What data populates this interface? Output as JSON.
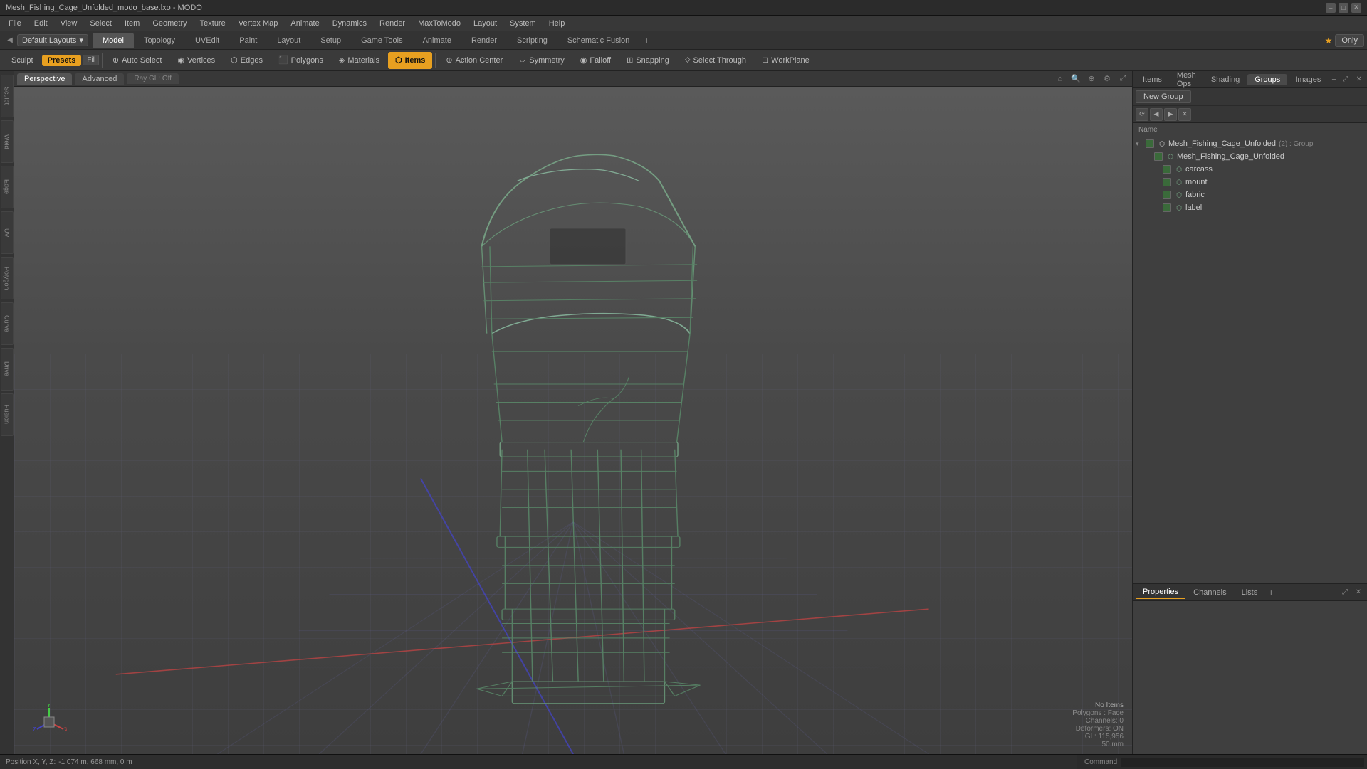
{
  "titleBar": {
    "title": "Mesh_Fishing_Cage_Unfolded_modo_base.lxo - MODO",
    "winControls": [
      "–",
      "□",
      "✕"
    ]
  },
  "menuBar": {
    "items": [
      "File",
      "Edit",
      "View",
      "Select",
      "Item",
      "Geometry",
      "Texture",
      "Vertex Map",
      "Animate",
      "Dynamics",
      "Render",
      "MaxToModo",
      "Layout",
      "System",
      "Help"
    ]
  },
  "layoutBar": {
    "selectorLabel": "Default Layouts",
    "tabs": [
      "Model",
      "Topology",
      "UVEdit",
      "Paint",
      "Layout",
      "Setup",
      "Game Tools",
      "Animate",
      "Render",
      "Scripting",
      "Schematic Fusion"
    ],
    "addTabLabel": "+",
    "rightLabel": "Only",
    "starIcon": "★"
  },
  "modeBar": {
    "sculpt": "Sculpt",
    "presets": "Presets",
    "autoSelect": "Auto Select",
    "vertices": "Vertices",
    "edges": "Edges",
    "polygons": "Polygons",
    "materials": "Materials",
    "items": "Items",
    "actionCenter": "Action Center",
    "symmetry": "Symmetry",
    "falloff": "Falloff",
    "snapping": "Snapping",
    "selectThrough": "Select Through",
    "workplane": "WorkPlane"
  },
  "viewport": {
    "tabs": [
      "Perspective",
      "Advanced"
    ],
    "rayGL": "Ray GL: Off",
    "axisColors": {
      "x": "#cc4444",
      "y": "#44cc44",
      "z": "#4444cc"
    }
  },
  "viewportInfo": {
    "noItems": "No Items",
    "polygons": "Polygons : Face",
    "channels": "Channels: 0",
    "deformers": "Deformers: ON",
    "gl": "GL: 115,956",
    "size": "50 mm"
  },
  "statusBar": {
    "position": "Position X, Y, Z:",
    "coords": "-1.074 m, 668 mm, 0 m"
  },
  "rightPanel": {
    "tabs": [
      "Items",
      "Mesh Ops",
      "Shading",
      "Groups",
      "Images"
    ],
    "addTab": "+",
    "newGroupBtn": "New Group",
    "nameHeader": "Name",
    "toolIcons": [
      "⟳",
      "◀",
      "▶",
      "✕"
    ],
    "treeItems": [
      {
        "label": "Mesh_Fishing_Cage_Unfolded",
        "suffix": "(2) : Group",
        "level": 0,
        "hasArrow": true,
        "checked": true,
        "type": "group"
      },
      {
        "label": "Mesh_Fishing_Cage_Unfolded",
        "suffix": "",
        "level": 1,
        "hasArrow": false,
        "checked": true,
        "type": "mesh"
      },
      {
        "label": "carcass",
        "suffix": "",
        "level": 2,
        "hasArrow": false,
        "checked": true,
        "type": "mesh"
      },
      {
        "label": "mount",
        "suffix": "",
        "level": 2,
        "hasArrow": false,
        "checked": true,
        "type": "mesh"
      },
      {
        "label": "fabric",
        "suffix": "",
        "level": 2,
        "hasArrow": false,
        "checked": true,
        "type": "mesh"
      },
      {
        "label": "label",
        "suffix": "",
        "level": 2,
        "hasArrow": false,
        "checked": true,
        "type": "mesh"
      }
    ]
  },
  "propertiesPanel": {
    "tabs": [
      "Properties",
      "Channels",
      "Lists"
    ],
    "addTab": "+"
  },
  "commandBar": {
    "label": "Command",
    "placeholder": ""
  },
  "leftSidebar": {
    "items": [
      "Sculpt",
      "Weld",
      "Edge",
      "UV",
      "Polygon",
      "Curve",
      "Drive",
      "Fusion"
    ]
  }
}
